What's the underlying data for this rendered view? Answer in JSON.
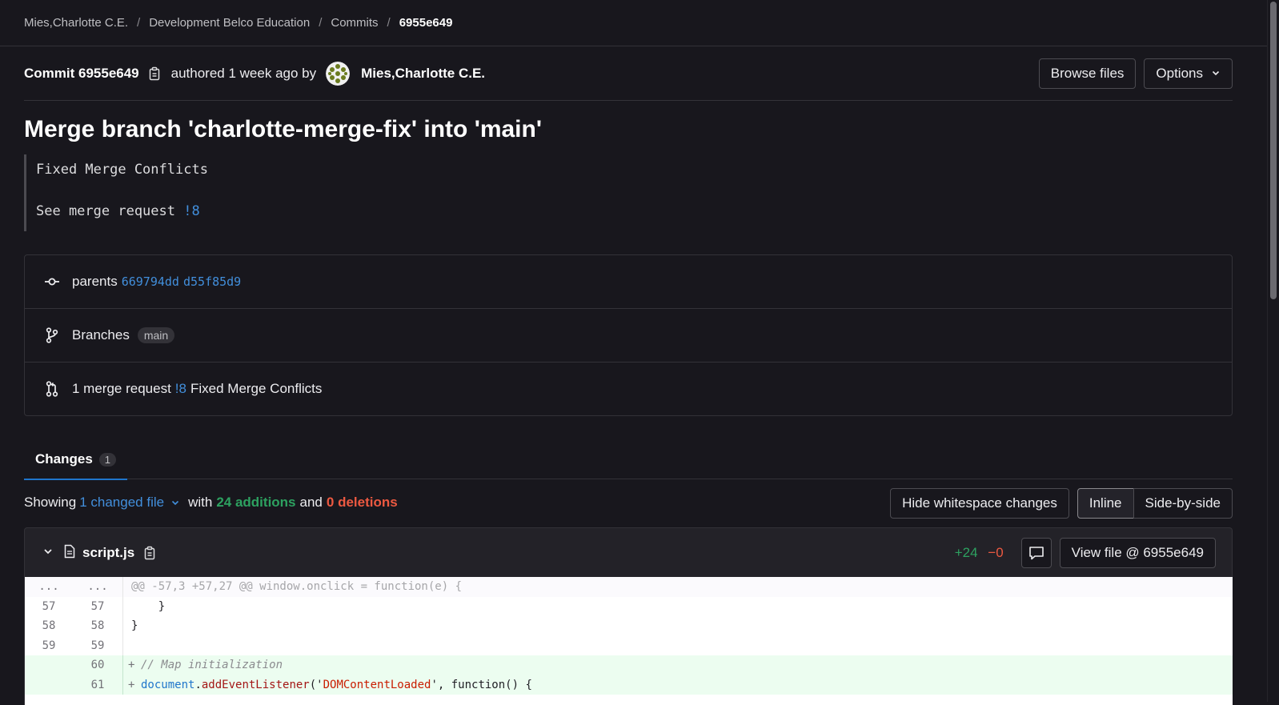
{
  "breadcrumb": {
    "items": [
      "Mies,Charlotte C.E.",
      "Development Belco Education",
      "Commits"
    ],
    "current": "6955e649",
    "separator": "/"
  },
  "commit": {
    "label": "Commit 6955e649",
    "authored": "authored 1 week ago by",
    "author": "Mies,Charlotte C.E.",
    "title": "Merge branch 'charlotte-merge-fix' into 'main'",
    "message_line1": "Fixed Merge Conflicts",
    "message_line2_prefix": "See merge request ",
    "message_line2_link": "!8"
  },
  "actions": {
    "browse_files": "Browse files",
    "options": "Options"
  },
  "info": {
    "parents_label": "parents",
    "parent1": "669794dd",
    "parent2": "d55f85d9",
    "branches_label": "Branches",
    "branch": "main",
    "mr_prefix": "1 merge request",
    "mr_link": "!8",
    "mr_title": "Fixed Merge Conflicts"
  },
  "tabs": {
    "changes_label": "Changes",
    "changes_count": "1"
  },
  "summary": {
    "showing": "Showing",
    "changed_files": "1 changed file",
    "with": "with",
    "additions": "24 additions",
    "and": "and",
    "deletions": "0 deletions"
  },
  "view_controls": {
    "hide_whitespace": "Hide whitespace changes",
    "inline": "Inline",
    "side_by_side": "Side-by-side"
  },
  "file": {
    "name": "script.js",
    "additions": "+24",
    "deletions": "−0",
    "view_file": "View file @ 6955e649"
  },
  "diff": {
    "hunk": "@@ -57,3 +57,27 @@ window.onclick = function(e) {",
    "hunk_old": "...",
    "hunk_new": "...",
    "lines": [
      {
        "old": "57",
        "new": "57",
        "code": "    }"
      },
      {
        "old": "58",
        "new": "58",
        "code": "}"
      },
      {
        "old": "59",
        "new": "59",
        "code": ""
      }
    ],
    "added": [
      {
        "new": "60",
        "comment": "// Map initialization"
      },
      {
        "new": "61",
        "obj": "document",
        "dot": ".",
        "fn": "addEventListener",
        "p1": "('",
        "str": "DOMContentLoaded",
        "p2": "', function() {"
      }
    ]
  },
  "colors": {
    "background": "#18171d",
    "link": "#428fdc",
    "addition": "#2da160",
    "deletion": "#ec5941",
    "tab_underline": "#1f75cb"
  }
}
